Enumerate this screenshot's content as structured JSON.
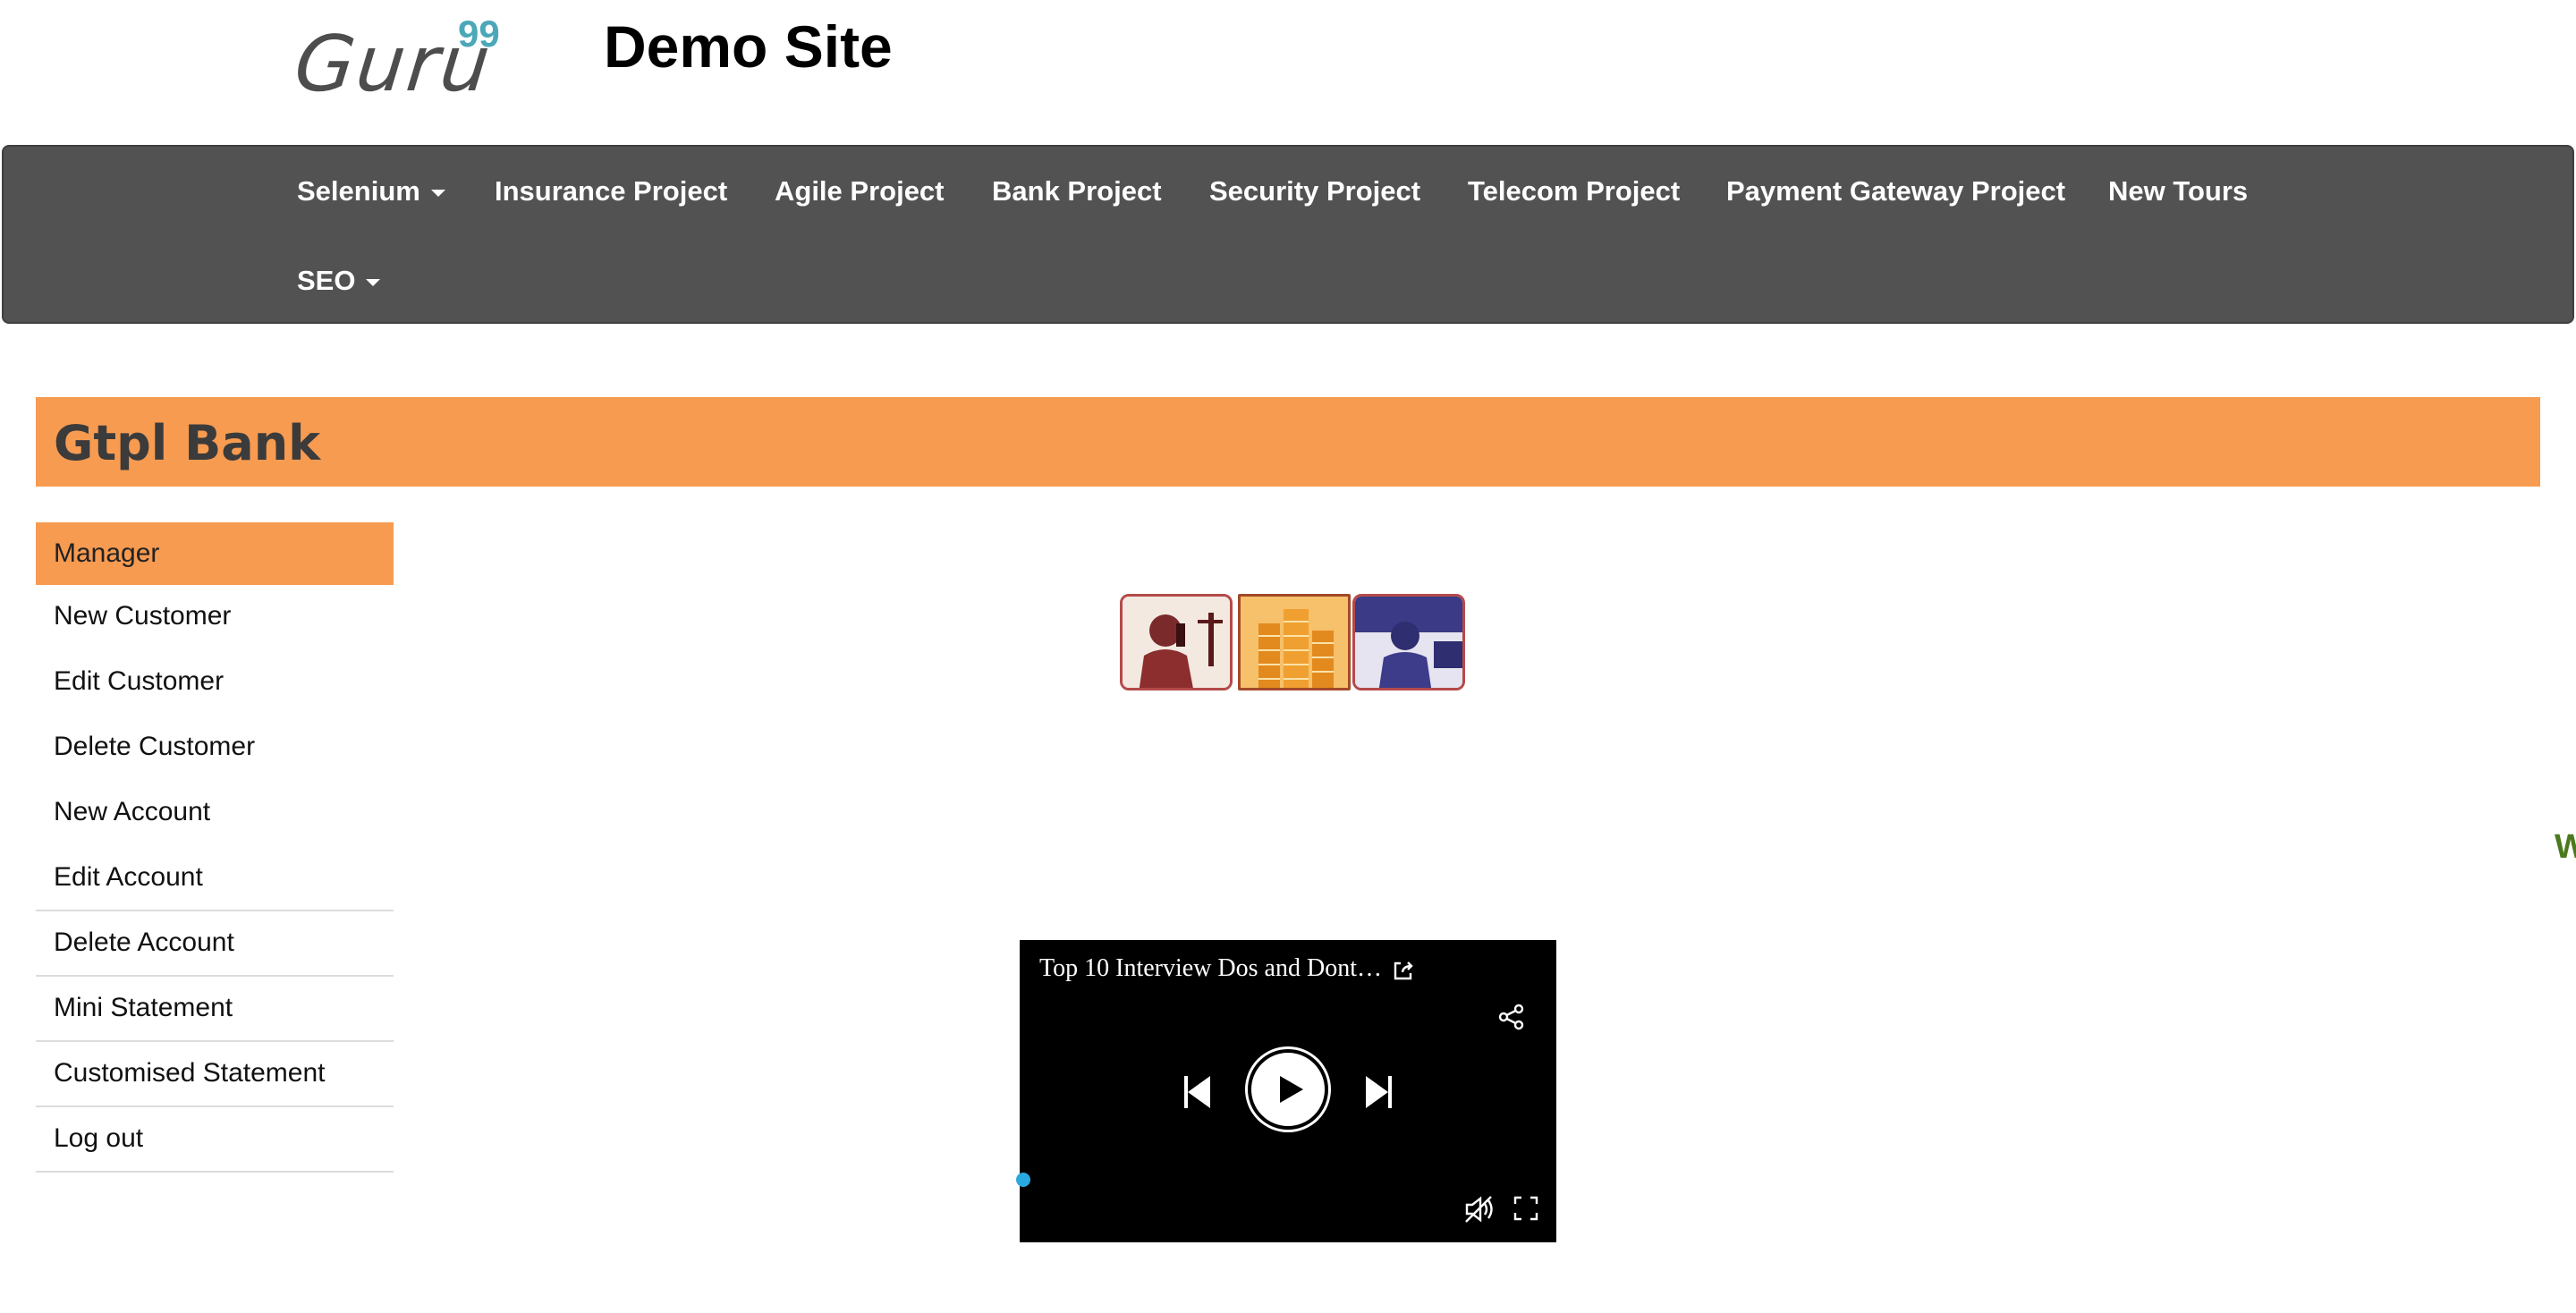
{
  "header": {
    "logo_text": "Guru",
    "logo_superscript": "99",
    "site_title": "Demo Site"
  },
  "nav": {
    "items": [
      {
        "label": "Selenium",
        "has_dropdown": true
      },
      {
        "label": "Insurance Project",
        "has_dropdown": false
      },
      {
        "label": "Agile Project",
        "has_dropdown": false
      },
      {
        "label": "Bank Project",
        "has_dropdown": false
      },
      {
        "label": "Security Project",
        "has_dropdown": false
      },
      {
        "label": "Telecom Project",
        "has_dropdown": false
      },
      {
        "label": "Payment Gateway Project",
        "has_dropdown": false
      },
      {
        "label": "New Tours",
        "has_dropdown": false
      },
      {
        "label": "SEO",
        "has_dropdown": true
      }
    ]
  },
  "bank": {
    "title": "Gtpl Bank"
  },
  "menu": {
    "items": [
      {
        "label": "Manager"
      },
      {
        "label": "New Customer"
      },
      {
        "label": "Edit Customer"
      },
      {
        "label": "Delete Customer"
      },
      {
        "label": "New Account"
      },
      {
        "label": "Edit Account"
      },
      {
        "label": "Delete Account"
      },
      {
        "label": "Mini Statement"
      },
      {
        "label": "Customised Statement"
      },
      {
        "label": "Log out"
      }
    ]
  },
  "edge_text": "W",
  "video": {
    "title": "Top 10 Interview Dos and Dont…",
    "icons": [
      "external-link-icon",
      "share-icon",
      "previous-icon",
      "play-icon",
      "next-icon",
      "mute-icon",
      "fullscreen-icon"
    ]
  },
  "colors": {
    "nav_bg": "#525252",
    "accent_orange": "#f79b51",
    "logo_teal": "#4aa8b8",
    "progress_blue": "#2aa8e0",
    "edge_text_green": "#4a7a1d"
  }
}
